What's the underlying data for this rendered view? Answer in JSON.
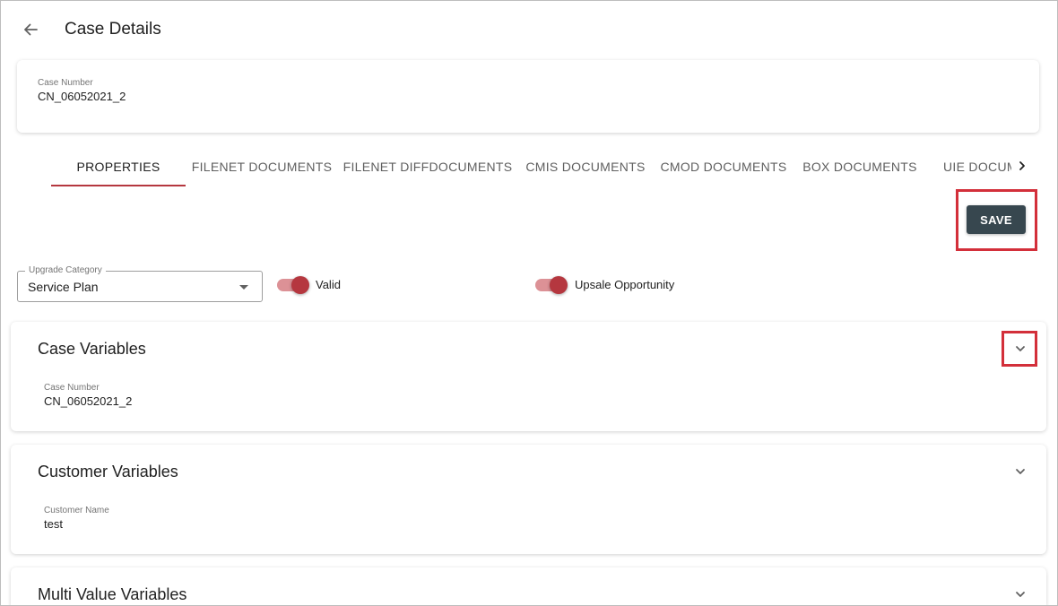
{
  "header": {
    "title": "Case Details",
    "back_icon": "arrow-left-icon"
  },
  "case_card": {
    "label": "Case Number",
    "value": "CN_06052021_2"
  },
  "tabs": [
    {
      "label": "PROPERTIES",
      "active": true
    },
    {
      "label": "FILENET DOCUMENTS"
    },
    {
      "label": "FILENET DIFFDOCUMENTS"
    },
    {
      "label": "CMIS DOCUMENTS"
    },
    {
      "label": "CMOD DOCUMENTS"
    },
    {
      "label": "BOX DOCUMENTS"
    },
    {
      "label": "UIE DOCUMENTS"
    }
  ],
  "toolbar": {
    "save_label": "SAVE"
  },
  "controls": {
    "upgrade_category": {
      "label": "Upgrade Category",
      "value": "Service Plan"
    },
    "valid_toggle": {
      "label": "Valid",
      "on": true
    },
    "upsale_toggle": {
      "label": "Upsale Opportunity",
      "on": true
    }
  },
  "panels": {
    "case_variables": {
      "title": "Case Variables",
      "field_label": "Case Number",
      "field_value": "CN_06052021_2"
    },
    "customer_variables": {
      "title": "Customer Variables",
      "field_label": "Customer Name",
      "field_value": "test"
    },
    "multi_value_variables": {
      "title": "Multi Value Variables"
    }
  },
  "colors": {
    "accent": "#b5373f",
    "save_button": "#37474f",
    "highlight": "#d32f3a"
  }
}
